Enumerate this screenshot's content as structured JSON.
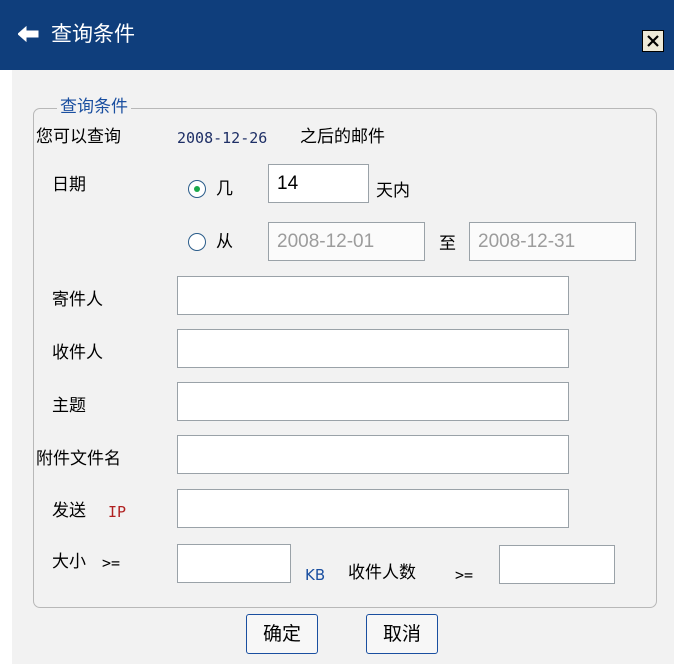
{
  "window": {
    "title": "查询条件",
    "close_label": "✕"
  },
  "form": {
    "legend": "查询条件",
    "info_prefix": "您可以查询",
    "info_date": "2008-12-26",
    "info_suffix": "之后的邮件",
    "date_label": "日期",
    "radio_days_label": "几",
    "days_value": "14",
    "days_suffix": "天内",
    "radio_range_label": "从",
    "range_from": "2008-12-01",
    "range_to_label": "至",
    "range_to": "2008-12-31",
    "sender_label": "寄件人",
    "recipient_label": "收件人",
    "subject_label": "主题",
    "attachment_label": "附件文件名",
    "send_ip_label_1": "发送",
    "send_ip_label_2": "IP",
    "size_label_1": "大小",
    "size_label_2": ">=",
    "kb_label": "KB",
    "recipients_count_label": "收件人数",
    "recipients_count_op": ">="
  },
  "buttons": {
    "ok": "确定",
    "cancel": "取消"
  },
  "selected_radio": "days"
}
